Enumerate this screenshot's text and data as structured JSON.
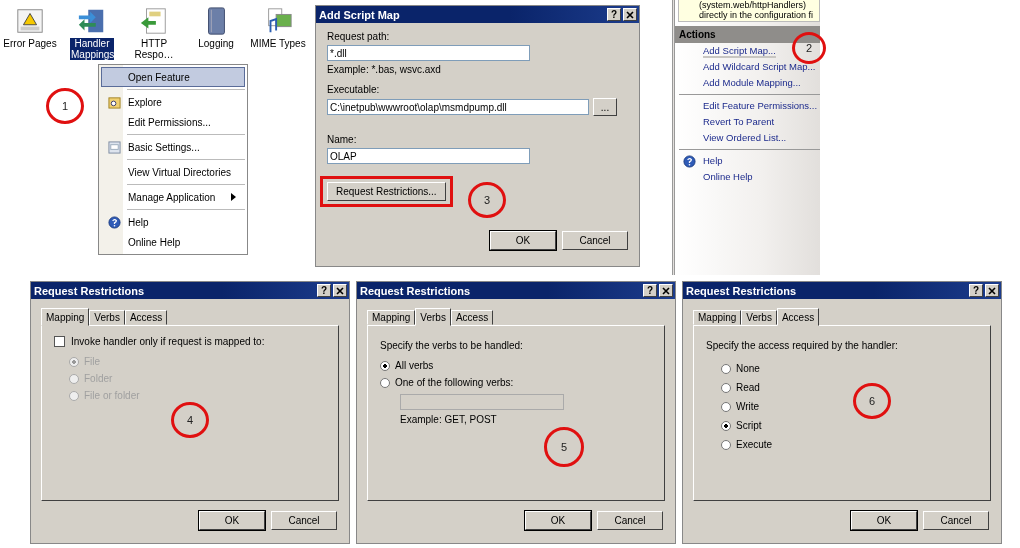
{
  "feature_view": {
    "icons": [
      {
        "label": "Error Pages",
        "selected": false,
        "kind": "error"
      },
      {
        "label": "Handler Mappings",
        "selected": true,
        "kind": "handler"
      },
      {
        "label": "HTTP Respo…",
        "selected": false,
        "kind": "http"
      },
      {
        "label": "Logging",
        "selected": false,
        "kind": "log"
      },
      {
        "label": "MIME Types",
        "selected": false,
        "kind": "mime"
      }
    ],
    "context_menu": {
      "groups": [
        [
          {
            "label": "Open Feature",
            "selected": true,
            "kind": "plain",
            "submenu": false
          }
        ],
        [
          {
            "label": "Explore",
            "selected": false,
            "kind": "explore",
            "submenu": false
          },
          {
            "label": "Edit Permissions...",
            "selected": false,
            "kind": "plain",
            "submenu": false
          }
        ],
        [
          {
            "label": "Basic Settings...",
            "selected": false,
            "kind": "settings",
            "submenu": false
          }
        ],
        [
          {
            "label": "View Virtual Directories",
            "selected": false,
            "kind": "plain",
            "submenu": false
          }
        ],
        [
          {
            "label": "Manage Application",
            "selected": false,
            "kind": "plain",
            "submenu": true
          }
        ],
        [
          {
            "label": "Help",
            "selected": false,
            "kind": "help",
            "submenu": false
          },
          {
            "label": "Online Help",
            "selected": false,
            "kind": "plain",
            "submenu": false
          }
        ]
      ]
    },
    "callout": "1"
  },
  "add_script_map": {
    "title": "Add Script Map",
    "help_glyph": "?",
    "request_path": {
      "label": "Request path:",
      "value": "*.dll",
      "hint": "Example: *.bas, wsvc.axd"
    },
    "executable": {
      "label": "Executable:",
      "value": "C:\\inetpub\\wwwroot\\olap\\msmdpump.dll",
      "browse": "..."
    },
    "name": {
      "label": "Name:",
      "value": "OLAP"
    },
    "restrictions_button": {
      "label": "Request Restrictions...",
      "highlighted": true
    },
    "ok": "OK",
    "cancel": "Cancel",
    "callout": "3"
  },
  "actions_pane": {
    "info_lines": [
      "(system.web/httpHandlers)",
      "directly in the configuration fi"
    ],
    "header": "Actions",
    "groups": [
      [
        {
          "label": "Add Script Map...",
          "kind": "plain",
          "hovered": true
        },
        {
          "label": "Add Wildcard Script Map...",
          "kind": "plain",
          "hovered": false
        },
        {
          "label": "Add Module Mapping...",
          "kind": "plain",
          "hovered": false
        }
      ],
      [
        {
          "label": "Edit Feature Permissions...",
          "kind": "plain",
          "hovered": false
        },
        {
          "label": "Revert To Parent",
          "kind": "plain",
          "hovered": false
        },
        {
          "label": "View Ordered List...",
          "kind": "plain",
          "hovered": false
        }
      ],
      [
        {
          "label": "Help",
          "kind": "help",
          "hovered": false
        },
        {
          "label": "Online Help",
          "kind": "plain",
          "hovered": false
        }
      ]
    ],
    "callout": "2"
  },
  "restriction_dialogs": [
    {
      "title": "Request Restrictions",
      "help_glyph": "?",
      "kind": "mapping",
      "tabs": [
        {
          "label": "Mapping",
          "selected": true
        },
        {
          "label": "Verbs",
          "selected": false
        },
        {
          "label": "Access",
          "selected": false
        }
      ],
      "checkbox": {
        "label": "Invoke handler only if request is mapped to:",
        "checked": false
      },
      "options": [
        {
          "label": "File",
          "selected": true,
          "disabled": true
        },
        {
          "label": "Folder",
          "selected": false,
          "disabled": true
        },
        {
          "label": "File or folder",
          "selected": false,
          "disabled": true
        }
      ],
      "ok": "OK",
      "cancel": "Cancel",
      "callout": "4"
    },
    {
      "title": "Request Restrictions",
      "help_glyph": "?",
      "kind": "verbs",
      "tabs": [
        {
          "label": "Mapping",
          "selected": false
        },
        {
          "label": "Verbs",
          "selected": true
        },
        {
          "label": "Access",
          "selected": false
        }
      ],
      "prompt": "Specify the verbs to be handled:",
      "options": [
        {
          "label": "All verbs",
          "selected": true,
          "disabled": false
        },
        {
          "label": "One of the following verbs:",
          "selected": false,
          "disabled": false
        }
      ],
      "hint": "Example: GET, POST",
      "ok": "OK",
      "cancel": "Cancel",
      "callout": "5"
    },
    {
      "title": "Request Restrictions",
      "help_glyph": "?",
      "kind": "access",
      "tabs": [
        {
          "label": "Mapping",
          "selected": false
        },
        {
          "label": "Verbs",
          "selected": false
        },
        {
          "label": "Access",
          "selected": true
        }
      ],
      "prompt": "Specify the access required by the handler:",
      "options": [
        {
          "label": "None",
          "selected": false,
          "disabled": false
        },
        {
          "label": "Read",
          "selected": false,
          "disabled": false
        },
        {
          "label": "Write",
          "selected": false,
          "disabled": false
        },
        {
          "label": "Script",
          "selected": true,
          "disabled": false
        },
        {
          "label": "Execute",
          "selected": false,
          "disabled": false
        }
      ],
      "ok": "OK",
      "cancel": "Cancel",
      "callout": "6"
    }
  ]
}
